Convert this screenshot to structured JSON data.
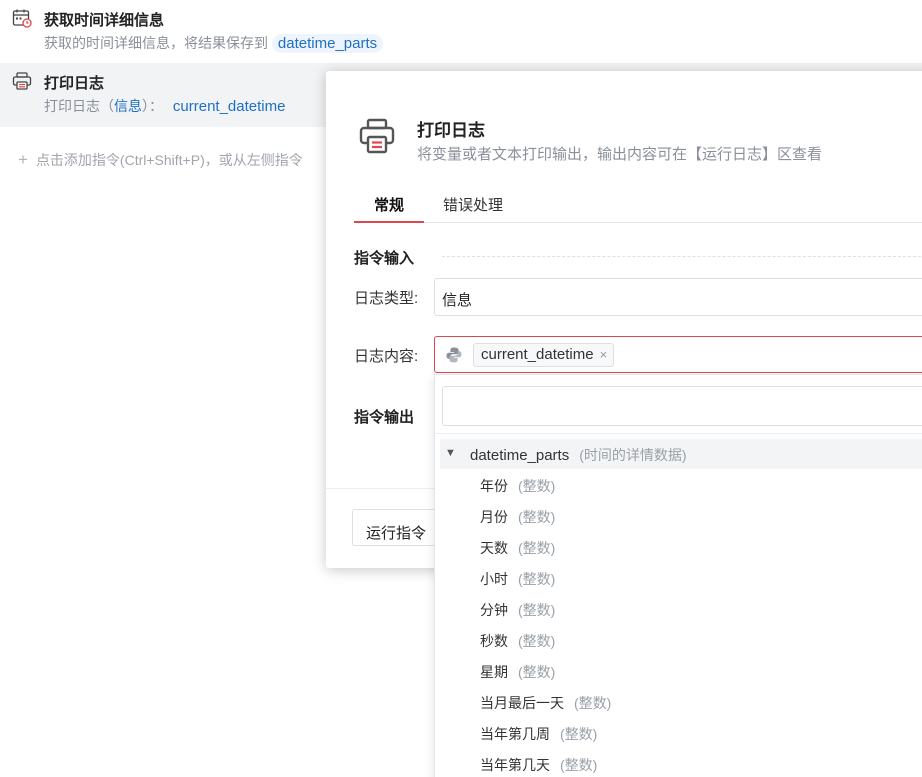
{
  "flow": {
    "step1": {
      "title": "获取时间详细信息",
      "desc_prefix": "获取的时间详细信息，将结果保存到",
      "var": "datetime_parts"
    },
    "step2": {
      "title": "打印日志",
      "desc_prefix": "打印日志（",
      "log_type": "信息",
      "desc_mid": "）：",
      "var": "current_datetime"
    },
    "add_hint": "点击添加指令(Ctrl+Shift+P)，或从左侧指令"
  },
  "dialog": {
    "title": "打印日志",
    "subtitle": "将变量或者文本打印输出，输出内容可在【运行日志】区查看",
    "tabs": [
      "常规",
      "错误处理"
    ],
    "section_input": "指令输入",
    "section_output": "指令输出",
    "log_type_label": "日志类型:",
    "log_type_value": "信息",
    "log_content_label": "日志内容:",
    "log_content_chip": "current_datetime",
    "chip_close": "×",
    "run_button": "运行指令"
  },
  "dropdown": {
    "group": {
      "caret": "▼",
      "name": "datetime_parts",
      "type": "(时间的详情数据)"
    },
    "items": [
      {
        "name": "年份",
        "type": "(整数)"
      },
      {
        "name": "月份",
        "type": "(整数)"
      },
      {
        "name": "天数",
        "type": "(整数)"
      },
      {
        "name": "小时",
        "type": "(整数)"
      },
      {
        "name": "分钟",
        "type": "(整数)"
      },
      {
        "name": "秒数",
        "type": "(整数)"
      },
      {
        "name": "星期",
        "type": "(整数)"
      },
      {
        "name": "当月最后一天",
        "type": "(整数)"
      },
      {
        "name": "当年第几周",
        "type": "(整数)"
      },
      {
        "name": "当年第几天",
        "type": "(整数)"
      }
    ]
  },
  "colors": {
    "accent_red": "#e0464e",
    "link_blue": "#1f6fc5",
    "muted_text": "#8a8f99"
  },
  "icons": {
    "step1": "calendar-clock-icon",
    "step2": "printer-icon",
    "dialog": "printer-icon",
    "content": "python-icon",
    "add": "plus-icon"
  }
}
